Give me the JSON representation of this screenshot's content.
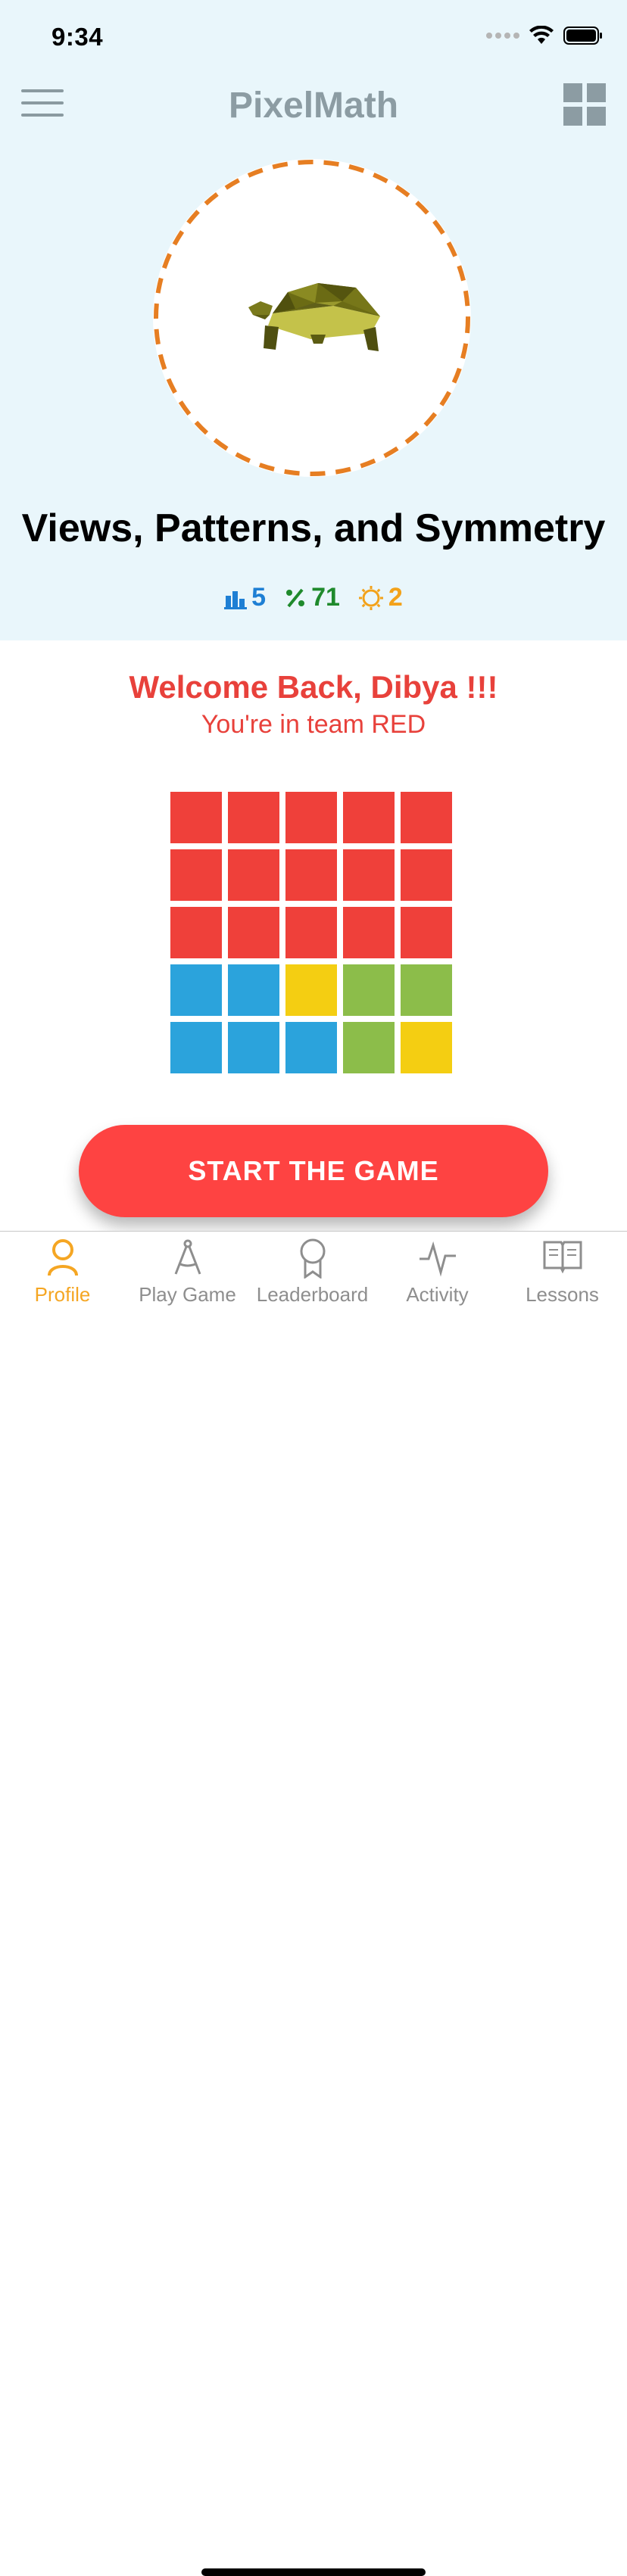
{
  "status_bar": {
    "time": "9:34"
  },
  "header": {
    "title": "PixelMath",
    "menu_icon": "hamburger-menu-icon",
    "grid_icon": "grid-view-icon"
  },
  "avatar": {
    "icon": "turtle-icon",
    "ring_color": "#e67e22"
  },
  "lesson": {
    "title": "Views, Patterns, and Symmetry"
  },
  "stats": [
    {
      "icon": "bar-chart-icon",
      "value": "5",
      "color": "#1e7fd4"
    },
    {
      "icon": "percent-icon",
      "value": "71",
      "color": "#1f8a2c"
    },
    {
      "icon": "sun-icon",
      "value": "2",
      "color": "#f3a21a"
    }
  ],
  "welcome": {
    "headline": "Welcome Back, Dibya !!!",
    "team_text": "You're in team RED"
  },
  "pixel_grid": {
    "colors": {
      "red": "#ef403a",
      "blue": "#2ba3dc",
      "yellow": "#f4ce12",
      "green": "#8cbd4a"
    },
    "rows": [
      [
        "red",
        "red",
        "red",
        "red",
        "red"
      ],
      [
        "red",
        "red",
        "red",
        "red",
        "red"
      ],
      [
        "red",
        "red",
        "red",
        "red",
        "red"
      ],
      [
        "blue",
        "blue",
        "yellow",
        "green",
        "green"
      ],
      [
        "blue",
        "blue",
        "blue",
        "green",
        "yellow"
      ]
    ]
  },
  "start_button": {
    "label": "START THE GAME"
  },
  "tabs": [
    {
      "label": "Profile",
      "icon": "profile-icon",
      "active": true
    },
    {
      "label": "Play Game",
      "icon": "compass-icon",
      "active": false
    },
    {
      "label": "Leaderboard",
      "icon": "award-ribbon-icon",
      "active": false
    },
    {
      "label": "Activity",
      "icon": "activity-pulse-icon",
      "active": false
    },
    {
      "label": "Lessons",
      "icon": "open-book-icon",
      "active": false
    }
  ],
  "theme": {
    "accent": "#fe4342",
    "active_tab": "#f5a623",
    "inactive_tab": "#8e8e8e",
    "top_background": "#e9f6fb"
  }
}
